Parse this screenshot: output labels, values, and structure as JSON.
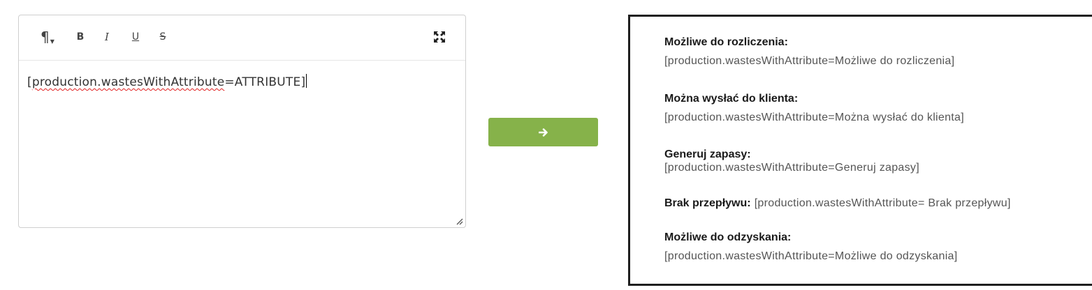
{
  "editor": {
    "toolbar": {
      "paragraph_icon": "¶",
      "bold_label": "B",
      "italic_label": "I",
      "underline_label": "U",
      "strikethrough_label": "S"
    },
    "content": {
      "open_bracket": "[",
      "misspelled_word": "production.wastesWithAttribute",
      "rest": "=ATTRIBUTE]"
    }
  },
  "convert_button": {
    "icon": "arrow-right-icon",
    "color": "#86b24a"
  },
  "preview": {
    "items": [
      {
        "label": "Możliwe do rozliczenia:",
        "value": "[production.wastesWithAttribute=Możliwe do rozliczenia]"
      },
      {
        "label": "Można wysłać do klienta:",
        "value": "[production.wastesWithAttribute=Można wysłać do klienta]"
      },
      {
        "label": "Generuj zapasy:",
        "value": "[production.wastesWithAttribute=Generuj zapasy]"
      },
      {
        "label": "Brak przepływu:",
        "value": "[production.wastesWithAttribute= Brak przepływu]"
      },
      {
        "label": "Możliwe do odzyskania:",
        "value": "[production.wastesWithAttribute=Możliwe do odzyskania]"
      }
    ]
  }
}
